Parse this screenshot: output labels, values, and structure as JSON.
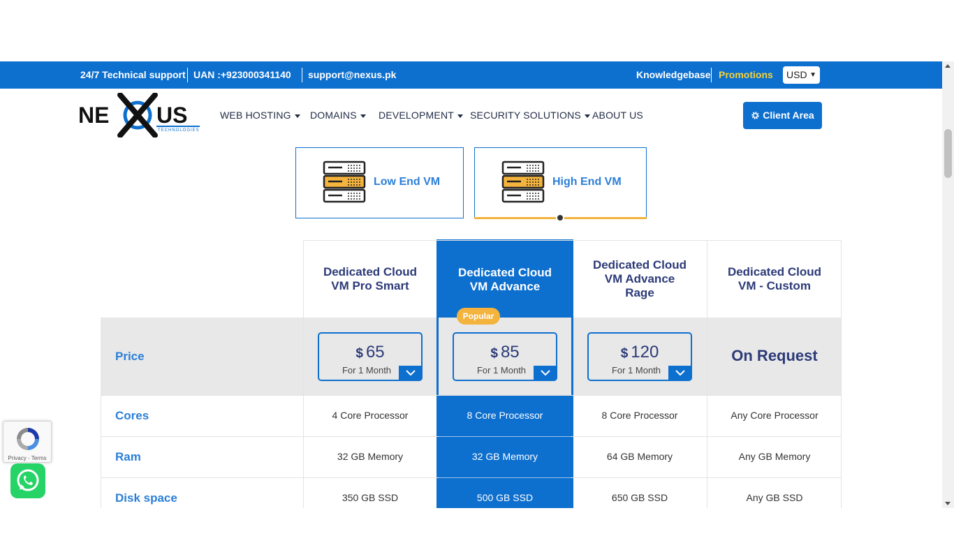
{
  "topbar": {
    "support": "24/7 Technical support",
    "phone": "UAN :+923000341140",
    "email": "support@nexus.pk",
    "knowledgebase": "Knowledgebase",
    "promotions": "Promotions",
    "currency": "USD"
  },
  "brand": {
    "name_left": "NE",
    "name_right": "US",
    "tagline": "TECHNOLOGIES"
  },
  "nav": {
    "items": [
      "WEB HOSTING",
      "DOMAINS",
      "DEVELOPMENT",
      "SECURITY SOLUTIONS",
      "ABOUT US"
    ],
    "client_area": "Client Area"
  },
  "tabs": [
    {
      "label": "Low End VM",
      "active": false
    },
    {
      "label": "High End VM",
      "active": true
    }
  ],
  "table": {
    "plans": [
      {
        "title_lines": [
          "Dedicated Cloud",
          "VM Pro Smart"
        ],
        "price_currency": "$",
        "price_value": "65",
        "price_period": "For 1 Month",
        "featured": false
      },
      {
        "title_lines": [
          "Dedicated Cloud",
          "VM Advance"
        ],
        "price_currency": "$",
        "price_value": "85",
        "price_period": "For 1 Month",
        "featured": true,
        "badge": "Popular"
      },
      {
        "title_lines": [
          "Dedicated Cloud",
          "VM Advance",
          "Rage"
        ],
        "price_currency": "$",
        "price_value": "120",
        "price_period": "For 1 Month",
        "featured": false
      },
      {
        "title_lines": [
          "Dedicated Cloud",
          "VM - Custom"
        ],
        "price_text": "On Request",
        "featured": false
      }
    ],
    "row_labels": [
      "Price",
      "Cores",
      "Ram",
      "Disk space"
    ],
    "rows": {
      "cores": [
        "4 Core Processor",
        "8 Core Processor",
        "8 Core Processor",
        "Any Core Processor"
      ],
      "ram": [
        "32 GB Memory",
        "32 GB Memory",
        "64 GB Memory",
        "Any GB Memory"
      ],
      "disk": [
        "350 GB SSD",
        "500 GB SSD",
        "650 GB SSD",
        "Any GB SSD"
      ]
    }
  },
  "widgets": {
    "recaptcha_text": "Privacy - Terms"
  },
  "colors": {
    "primary": "#0d6fce",
    "accent": "#f3b33d",
    "heading": "#2c3a78",
    "promo": "#f5d33a"
  }
}
